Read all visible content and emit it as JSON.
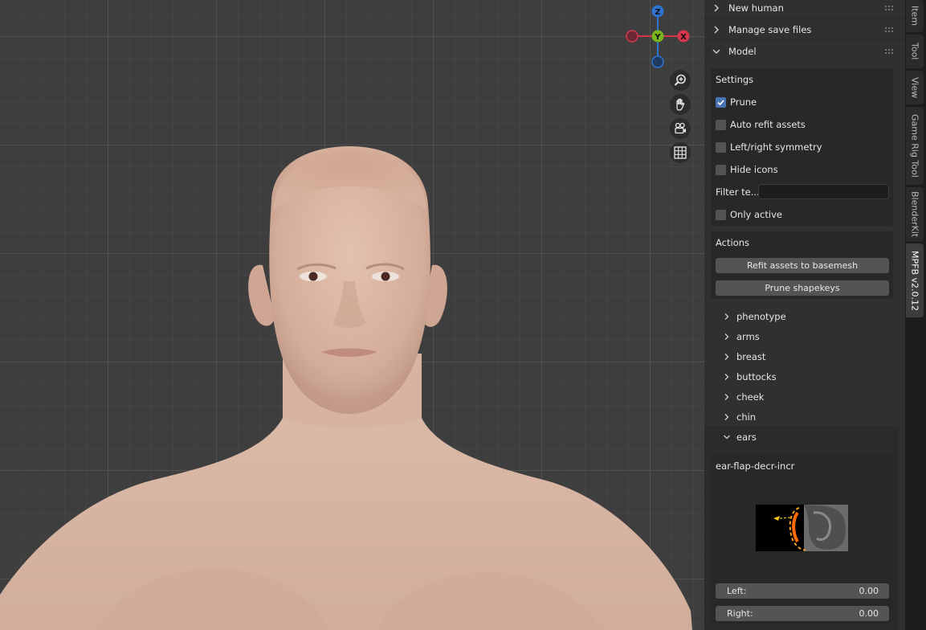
{
  "viewport": {
    "gizmo": {
      "z_label": "Z",
      "y_label": "Y",
      "x_label": "X"
    },
    "tools": [
      "zoom-icon",
      "hand-pan-icon",
      "camera-icon",
      "grid-icon"
    ]
  },
  "sidebar": {
    "headers": {
      "new_human": "New human",
      "manage_save_files": "Manage save files",
      "model": "Model"
    },
    "settings": {
      "title": "Settings",
      "prune": {
        "label": "Prune",
        "checked": true
      },
      "auto_refit": {
        "label": "Auto refit assets",
        "checked": false
      },
      "symmetry": {
        "label": "Left/right symmetry",
        "checked": false
      },
      "hide_icons": {
        "label": "Hide icons",
        "checked": false
      },
      "filter_label": "Filter te...",
      "filter_value": "",
      "only_active": {
        "label": "Only active",
        "checked": false
      }
    },
    "actions": {
      "title": "Actions",
      "refit_button": "Refit assets to basemesh",
      "prune_button": "Prune shapekeys"
    },
    "categories": [
      "phenotype",
      "arms",
      "breast",
      "buttocks",
      "cheek",
      "chin",
      "ears"
    ],
    "expanded_category": "ears",
    "ear_panel": {
      "title": "ear-flap-decr-incr",
      "left_label": "Left:",
      "left_value": "0.00",
      "right_label": "Right:",
      "right_value": "0.00"
    }
  },
  "tabs": [
    "Item",
    "Tool",
    "View",
    "Game Rig Tool",
    "BlenderKit",
    "MPFB v2.0.12"
  ],
  "active_tab": "MPFB v2.0.12",
  "colors": {
    "accent": "#4772b3",
    "gizmo_x": "#d7344d",
    "gizmo_y": "#7ab51d",
    "gizmo_z": "#2f73d3"
  }
}
